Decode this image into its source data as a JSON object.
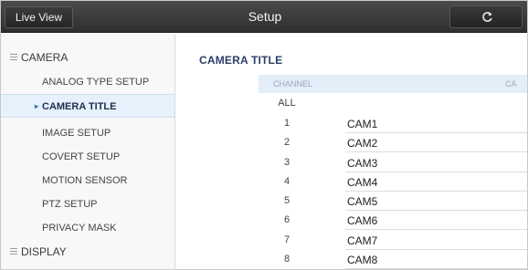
{
  "topbar": {
    "live_view_label": "Live View",
    "title": "Setup",
    "refresh_icon": "refresh-icon"
  },
  "sidebar": {
    "groups": [
      {
        "label": "CAMERA",
        "icon": "menu-lines-icon"
      },
      {
        "label": "DISPLAY",
        "icon": "menu-lines-icon"
      }
    ],
    "items": [
      {
        "label": "ANALOG TYPE SETUP"
      },
      {
        "label": "CAMERA TITLE",
        "active": true
      },
      {
        "label": "IMAGE SETUP"
      },
      {
        "label": "COVERT SETUP"
      },
      {
        "label": "MOTION SENSOR"
      },
      {
        "label": "PTZ SETUP"
      },
      {
        "label": "PRIVACY MASK"
      }
    ]
  },
  "main": {
    "section_title": "CAMERA TITLE",
    "table": {
      "header_channel": "CHANNEL",
      "header_title": "CA",
      "all_label": "ALL",
      "rows": [
        {
          "channel": "1",
          "title": "CAM1"
        },
        {
          "channel": "2",
          "title": "CAM2"
        },
        {
          "channel": "3",
          "title": "CAM3"
        },
        {
          "channel": "4",
          "title": "CAM4"
        },
        {
          "channel": "5",
          "title": "CAM5"
        },
        {
          "channel": "6",
          "title": "CAM6"
        },
        {
          "channel": "7",
          "title": "CAM7"
        },
        {
          "channel": "8",
          "title": "CAM8"
        }
      ]
    }
  },
  "colors": {
    "topbar": "#333333",
    "sidebar_bg": "#f7f8fa",
    "active_item_bg": "#e6f2fb",
    "header_row_bg": "#e3eef8",
    "section_title": "#2a3f6a"
  }
}
